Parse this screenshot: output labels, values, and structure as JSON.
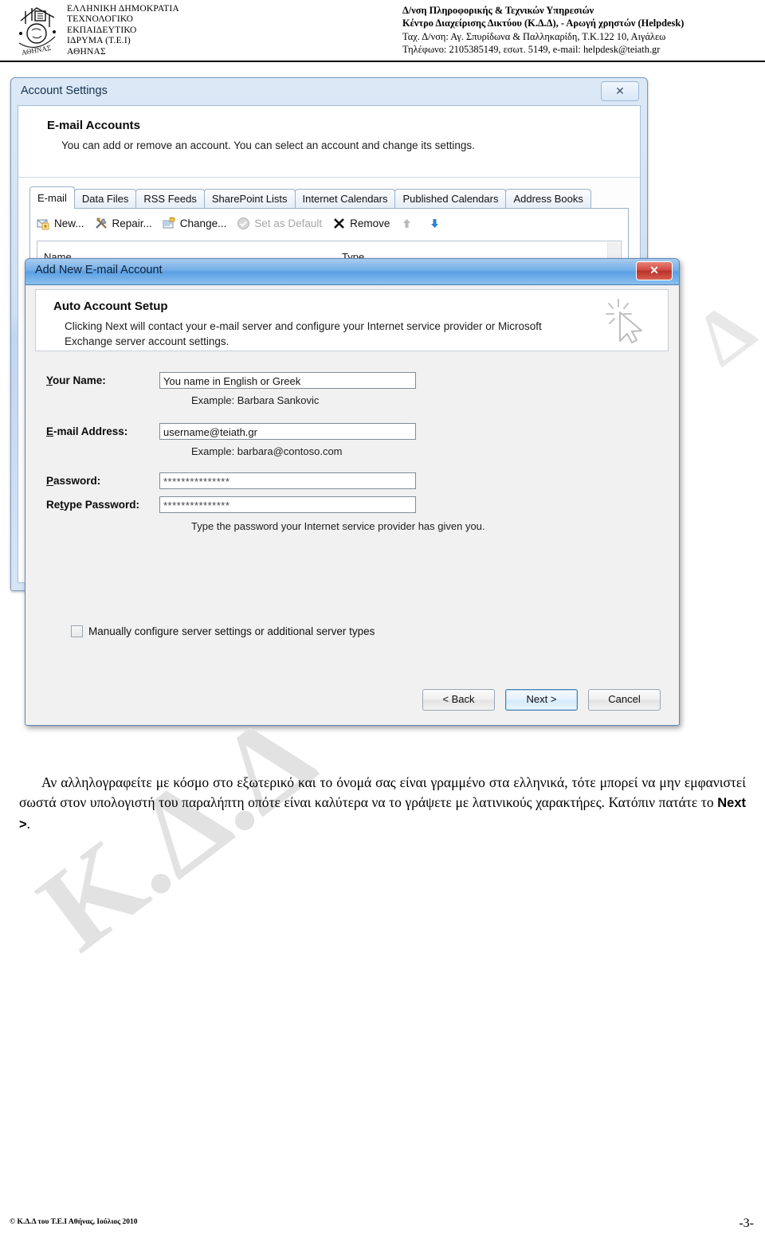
{
  "letterhead": {
    "logo_alt": "tei-athens-logo",
    "org_lines": [
      "ΕΛΛΗΝΙΚΗ ΔΗΜΟΚΡΑΤΙΑ",
      "ΤΕΧΝΟΛΟΓΙΚΟ",
      "ΕΚΠΑΙΔΕΥΤΙΚΟ",
      "ΙΔΡΥΜΑ (Τ.Ε.Ι)",
      "ΑΘΗΝΑΣ"
    ],
    "dept_lines": [
      "Δ/νση Πληροφορικής & Τεχνικών Υπηρεσιών",
      "Κέντρο Διαχείρισης Δικτύου (Κ.Δ.Δ), - Αρωγή χρηστών (Helpdesk)",
      "Ταχ. Δ/νση: Αγ. Σπυρίδωνα & Παλληκαρίδη, Τ.Κ.122 10, Αιγάλεω",
      "Τηλέφωνο: 2105385149, εσωτ. 5149,  e-mail: helpdesk@teiath.gr"
    ]
  },
  "account_settings": {
    "title": "Account Settings",
    "close_label": "✕",
    "heading": "E-mail Accounts",
    "subheading": "You can add or remove an account. You can select an account and change its settings.",
    "tabs": [
      {
        "label": "E-mail",
        "active": true
      },
      {
        "label": "Data Files",
        "active": false
      },
      {
        "label": "RSS Feeds",
        "active": false
      },
      {
        "label": "SharePoint Lists",
        "active": false
      },
      {
        "label": "Internet Calendars",
        "active": false
      },
      {
        "label": "Published Calendars",
        "active": false
      },
      {
        "label": "Address Books",
        "active": false
      }
    ],
    "toolbar": [
      {
        "label": "New...",
        "icon": "new-account-icon",
        "disabled": false
      },
      {
        "label": "Repair...",
        "icon": "repair-tools-icon",
        "disabled": false
      },
      {
        "label": "Change...",
        "icon": "change-account-icon",
        "disabled": false
      },
      {
        "label": "Set as Default",
        "icon": "set-default-check-icon",
        "disabled": true
      },
      {
        "label": "Remove",
        "icon": "remove-x-icon",
        "disabled": false
      },
      {
        "label": "",
        "icon": "move-up-arrow-icon",
        "disabled": true
      },
      {
        "label": "",
        "icon": "move-down-arrow-icon",
        "disabled": false
      }
    ],
    "columns": {
      "name": "Name",
      "type": "Type"
    }
  },
  "add_account_dialog": {
    "title": "Add New E-mail Account",
    "close_label": "✕",
    "banner_title": "Auto Account Setup",
    "banner_desc": "Clicking Next will contact your e-mail server and configure your Internet service provider or Microsoft Exchange server account settings.",
    "sparkle_icon": "sparkle-cursor-icon",
    "fields": {
      "your_name_label": "Your Name:",
      "your_name_value": "You name in English or Greek",
      "your_name_hint": "Example: Barbara Sankovic",
      "email_label": "E-mail Address:",
      "email_value": "username@teiath.gr",
      "email_hint": "Example: barbara@contoso.com",
      "password_label": "Password:",
      "password_value": "***************",
      "retype_label": "Retype Password:",
      "retype_value": "***************",
      "password_hint": "Type the password your Internet service provider has given you."
    },
    "manual_checkbox_label": "Manually configure server settings or additional server types",
    "manual_checkbox_checked": false,
    "buttons": {
      "back": "< Back",
      "next": "Next >",
      "cancel": "Cancel"
    }
  },
  "body": {
    "paragraph_part1": "Αν αλληλογραφείτε με κόσμο στο εξωτερικό και το όνομά σας είναι γραμμένο στα ελληνικά, τότε μπορεί να μην εμφανιστεί σωστά στον υπολογιστή του παραλήπτη οπότε είναι καλύτερα να το γράψετε με λατινικούς χαρακτήρες. Κατόπιν πατάτε το ",
    "paragraph_emphasis": "Next >",
    "paragraph_part2": "."
  },
  "watermark": {
    "main": "Κ.Δ.Δ",
    "secondary": "Δ"
  },
  "footer": {
    "copyright": "© Κ.Δ.Δ του Τ.Ε.Ι Αθήνας, Ιούλιος 2010",
    "page": "-3-"
  },
  "colors": {
    "titlebar_blue": "#5ba0e4",
    "close_red": "#b93229",
    "panel_gray": "#f1f1f1",
    "accent_border": "#5d87b5"
  }
}
